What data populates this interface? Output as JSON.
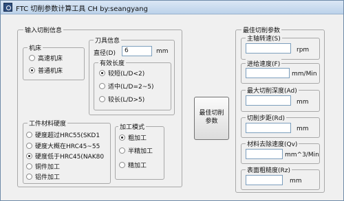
{
  "window": {
    "title": "FTC 切削参数计算工具 CH by:seangyang"
  },
  "input_panel": {
    "title": "输入切削信息",
    "machine": {
      "title": "机床",
      "options": [
        "高速机床",
        "普通机床"
      ],
      "selected": 1
    },
    "tool": {
      "title": "刀具信息",
      "diameter_label": "直径(D)",
      "diameter_value": "6",
      "diameter_unit": "mm",
      "effective_length": {
        "title": "有效长度",
        "options": [
          "较短(L/D<2)",
          "适中(L/D=2~5)",
          "较长(L/D>5)"
        ],
        "selected": 0
      }
    },
    "material": {
      "title": "工件材料硬度",
      "options": [
        "硬度超过HRC55(SKD1",
        "硬度大概在HRC45~55",
        "硬度低于HRC45(NAK80",
        "铜件加工",
        "铝件加工"
      ],
      "selected": 2
    },
    "mode": {
      "title": "加工模式",
      "options": [
        "粗加工",
        "半精加工",
        "精加工"
      ],
      "selected": 0
    }
  },
  "calc_button": {
    "line1": "最佳切削",
    "line2": "参数"
  },
  "output_panel": {
    "title": "最佳切削参数",
    "fields": [
      {
        "label": "主轴转速(S)",
        "value": "",
        "unit": "rpm"
      },
      {
        "label": "进给速度(F)",
        "value": "",
        "unit": "mm/Min"
      },
      {
        "label": "最大切削深度(Ad)",
        "value": "",
        "unit": "mm"
      },
      {
        "label": "切削步距(Rd)",
        "value": "",
        "unit": "mm"
      },
      {
        "label": "材料去除速度(Qv)",
        "value": "",
        "unit": "mm^3/Min"
      },
      {
        "label": "表面粗糙度(Rz)",
        "value": "",
        "unit": "mm"
      }
    ]
  }
}
